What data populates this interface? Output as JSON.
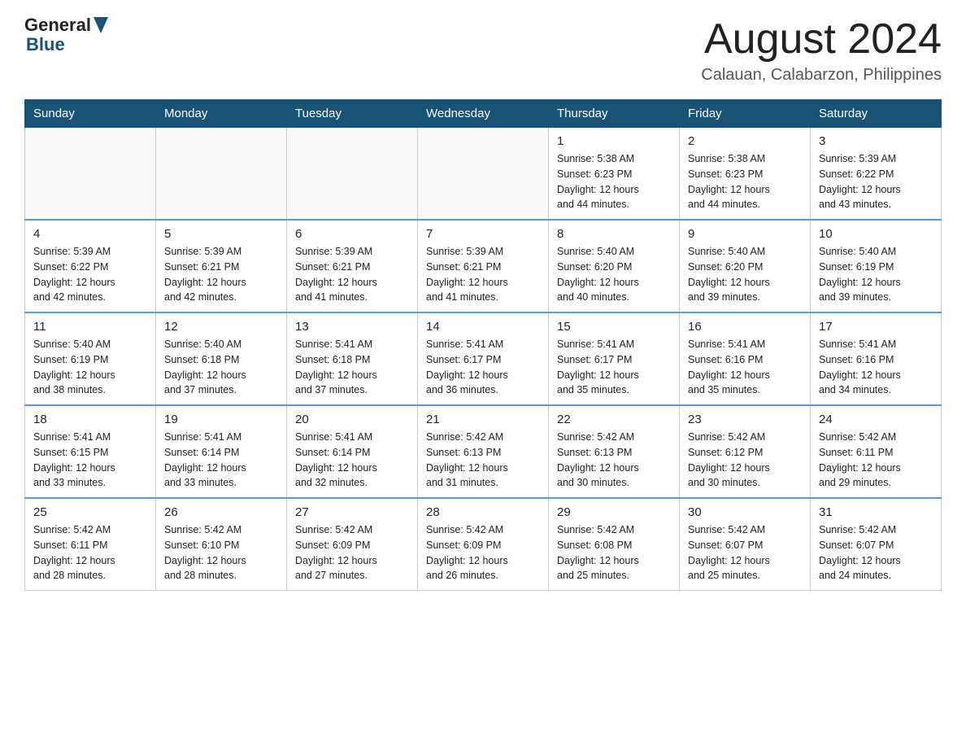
{
  "header": {
    "logo_general": "General",
    "logo_blue": "Blue",
    "month_title": "August 2024",
    "location": "Calauan, Calabarzon, Philippines"
  },
  "days_of_week": [
    "Sunday",
    "Monday",
    "Tuesday",
    "Wednesday",
    "Thursday",
    "Friday",
    "Saturday"
  ],
  "weeks": [
    {
      "days": [
        {
          "num": "",
          "info": ""
        },
        {
          "num": "",
          "info": ""
        },
        {
          "num": "",
          "info": ""
        },
        {
          "num": "",
          "info": ""
        },
        {
          "num": "1",
          "info": "Sunrise: 5:38 AM\nSunset: 6:23 PM\nDaylight: 12 hours\nand 44 minutes."
        },
        {
          "num": "2",
          "info": "Sunrise: 5:38 AM\nSunset: 6:23 PM\nDaylight: 12 hours\nand 44 minutes."
        },
        {
          "num": "3",
          "info": "Sunrise: 5:39 AM\nSunset: 6:22 PM\nDaylight: 12 hours\nand 43 minutes."
        }
      ]
    },
    {
      "days": [
        {
          "num": "4",
          "info": "Sunrise: 5:39 AM\nSunset: 6:22 PM\nDaylight: 12 hours\nand 42 minutes."
        },
        {
          "num": "5",
          "info": "Sunrise: 5:39 AM\nSunset: 6:21 PM\nDaylight: 12 hours\nand 42 minutes."
        },
        {
          "num": "6",
          "info": "Sunrise: 5:39 AM\nSunset: 6:21 PM\nDaylight: 12 hours\nand 41 minutes."
        },
        {
          "num": "7",
          "info": "Sunrise: 5:39 AM\nSunset: 6:21 PM\nDaylight: 12 hours\nand 41 minutes."
        },
        {
          "num": "8",
          "info": "Sunrise: 5:40 AM\nSunset: 6:20 PM\nDaylight: 12 hours\nand 40 minutes."
        },
        {
          "num": "9",
          "info": "Sunrise: 5:40 AM\nSunset: 6:20 PM\nDaylight: 12 hours\nand 39 minutes."
        },
        {
          "num": "10",
          "info": "Sunrise: 5:40 AM\nSunset: 6:19 PM\nDaylight: 12 hours\nand 39 minutes."
        }
      ]
    },
    {
      "days": [
        {
          "num": "11",
          "info": "Sunrise: 5:40 AM\nSunset: 6:19 PM\nDaylight: 12 hours\nand 38 minutes."
        },
        {
          "num": "12",
          "info": "Sunrise: 5:40 AM\nSunset: 6:18 PM\nDaylight: 12 hours\nand 37 minutes."
        },
        {
          "num": "13",
          "info": "Sunrise: 5:41 AM\nSunset: 6:18 PM\nDaylight: 12 hours\nand 37 minutes."
        },
        {
          "num": "14",
          "info": "Sunrise: 5:41 AM\nSunset: 6:17 PM\nDaylight: 12 hours\nand 36 minutes."
        },
        {
          "num": "15",
          "info": "Sunrise: 5:41 AM\nSunset: 6:17 PM\nDaylight: 12 hours\nand 35 minutes."
        },
        {
          "num": "16",
          "info": "Sunrise: 5:41 AM\nSunset: 6:16 PM\nDaylight: 12 hours\nand 35 minutes."
        },
        {
          "num": "17",
          "info": "Sunrise: 5:41 AM\nSunset: 6:16 PM\nDaylight: 12 hours\nand 34 minutes."
        }
      ]
    },
    {
      "days": [
        {
          "num": "18",
          "info": "Sunrise: 5:41 AM\nSunset: 6:15 PM\nDaylight: 12 hours\nand 33 minutes."
        },
        {
          "num": "19",
          "info": "Sunrise: 5:41 AM\nSunset: 6:14 PM\nDaylight: 12 hours\nand 33 minutes."
        },
        {
          "num": "20",
          "info": "Sunrise: 5:41 AM\nSunset: 6:14 PM\nDaylight: 12 hours\nand 32 minutes."
        },
        {
          "num": "21",
          "info": "Sunrise: 5:42 AM\nSunset: 6:13 PM\nDaylight: 12 hours\nand 31 minutes."
        },
        {
          "num": "22",
          "info": "Sunrise: 5:42 AM\nSunset: 6:13 PM\nDaylight: 12 hours\nand 30 minutes."
        },
        {
          "num": "23",
          "info": "Sunrise: 5:42 AM\nSunset: 6:12 PM\nDaylight: 12 hours\nand 30 minutes."
        },
        {
          "num": "24",
          "info": "Sunrise: 5:42 AM\nSunset: 6:11 PM\nDaylight: 12 hours\nand 29 minutes."
        }
      ]
    },
    {
      "days": [
        {
          "num": "25",
          "info": "Sunrise: 5:42 AM\nSunset: 6:11 PM\nDaylight: 12 hours\nand 28 minutes."
        },
        {
          "num": "26",
          "info": "Sunrise: 5:42 AM\nSunset: 6:10 PM\nDaylight: 12 hours\nand 28 minutes."
        },
        {
          "num": "27",
          "info": "Sunrise: 5:42 AM\nSunset: 6:09 PM\nDaylight: 12 hours\nand 27 minutes."
        },
        {
          "num": "28",
          "info": "Sunrise: 5:42 AM\nSunset: 6:09 PM\nDaylight: 12 hours\nand 26 minutes."
        },
        {
          "num": "29",
          "info": "Sunrise: 5:42 AM\nSunset: 6:08 PM\nDaylight: 12 hours\nand 25 minutes."
        },
        {
          "num": "30",
          "info": "Sunrise: 5:42 AM\nSunset: 6:07 PM\nDaylight: 12 hours\nand 25 minutes."
        },
        {
          "num": "31",
          "info": "Sunrise: 5:42 AM\nSunset: 6:07 PM\nDaylight: 12 hours\nand 24 minutes."
        }
      ]
    }
  ]
}
